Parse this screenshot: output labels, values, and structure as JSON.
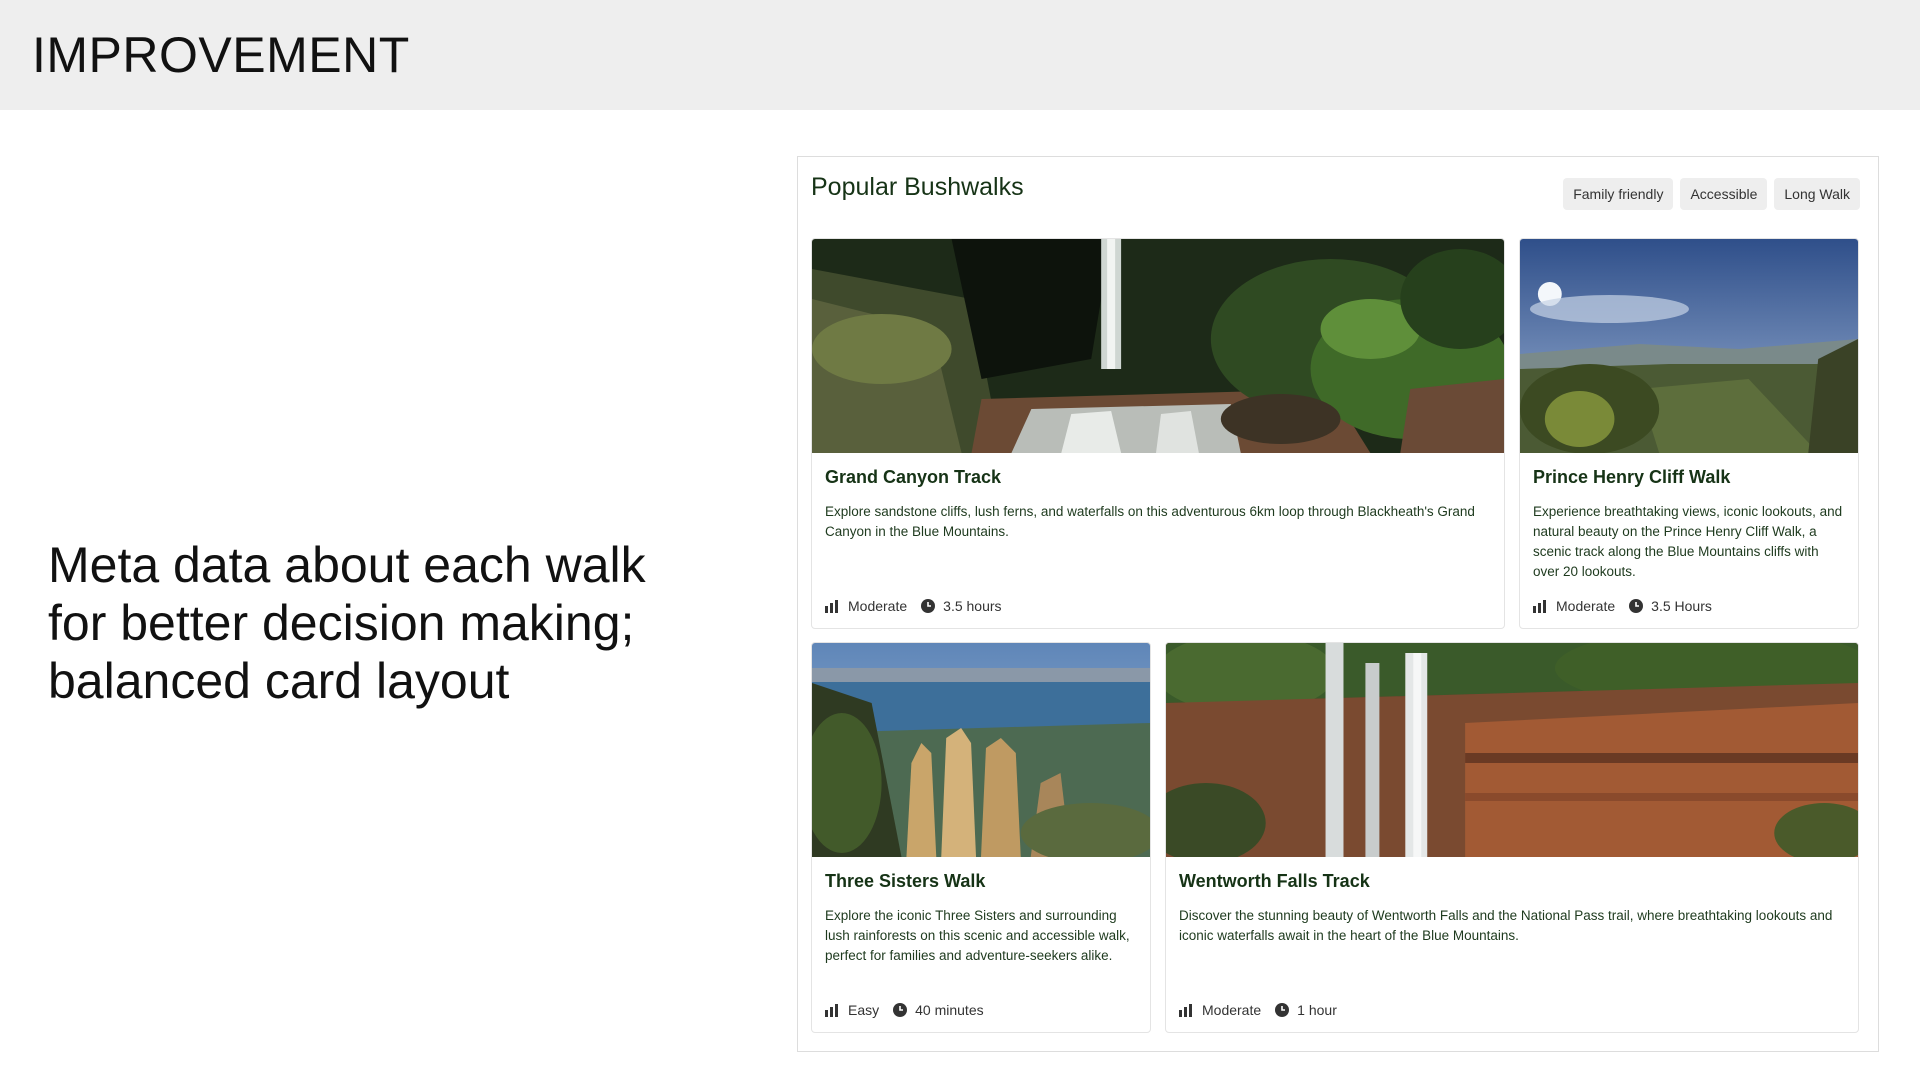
{
  "header": {
    "title": "IMPROVEMENT"
  },
  "caption": "Meta data about each walk for better decision making; balanced card layout",
  "panel": {
    "title": "Popular Bushwalks",
    "filters": [
      "Family friendly",
      "Accessible",
      "Long Walk"
    ]
  },
  "cards": [
    {
      "title": "Grand Canyon Track",
      "description": "Explore sandstone cliffs, lush ferns, and waterfalls on this adventurous 6km loop through Blackheath's Grand Canyon in the Blue Mountains.",
      "difficulty": "Moderate",
      "duration": "3.5 hours",
      "image": "waterfall-rainforest"
    },
    {
      "title": "Prince Henry Cliff Walk",
      "description": "Experience breathtaking views, iconic lookouts, and natural beauty on the Prince Henry Cliff Walk, a scenic track along the Blue Mountains cliffs with over 20 lookouts.",
      "difficulty": "Moderate",
      "duration": "3.5 Hours",
      "image": "valley-view"
    },
    {
      "title": "Three Sisters Walk",
      "description": "Explore the iconic Three Sisters and surrounding lush rainforests on this scenic and accessible walk, perfect for families and adventure-seekers alike.",
      "difficulty": "Easy",
      "duration": "40 minutes",
      "image": "three-sisters-rocks"
    },
    {
      "title": "Wentworth Falls Track",
      "description": "Discover the stunning beauty of Wentworth Falls and the National Pass trail, where breathtaking lookouts and iconic waterfalls await in the heart of the Blue Mountains.",
      "difficulty": "Moderate",
      "duration": "1 hour",
      "image": "wentworth-falls-cliff"
    }
  ]
}
